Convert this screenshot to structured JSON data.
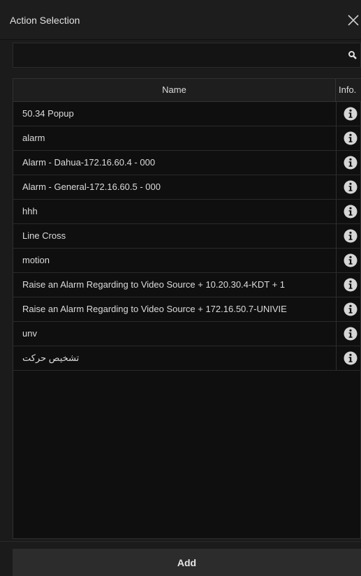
{
  "window": {
    "title": "Action Selection"
  },
  "search": {
    "value": "",
    "placeholder": ""
  },
  "table": {
    "columns": {
      "name": "Name",
      "info": "Info."
    },
    "rows": [
      "50.34 Popup",
      "alarm",
      "Alarm - Dahua-172.16.60.4 - 000",
      "Alarm - General-172.16.60.5 - 000",
      "hhh",
      "Line Cross",
      "motion",
      "Raise an Alarm Regarding to Video Source + 10.20.30.4-KDT + 1",
      "Raise an Alarm Regarding to Video Source + 172.16.50.7-UNIVIE",
      "unv",
      "تشخیص حرکت"
    ]
  },
  "footer": {
    "add_label": "Add"
  },
  "icons": {
    "close": "close-icon",
    "search": "search-icon",
    "info": "info-icon"
  },
  "colors": {
    "background": "#1b1b1b",
    "table_bg": "#0f0f0f",
    "header_bg": "#1e1e1e",
    "button_bg": "#2c2c2c",
    "text": "#dcdcdc"
  }
}
